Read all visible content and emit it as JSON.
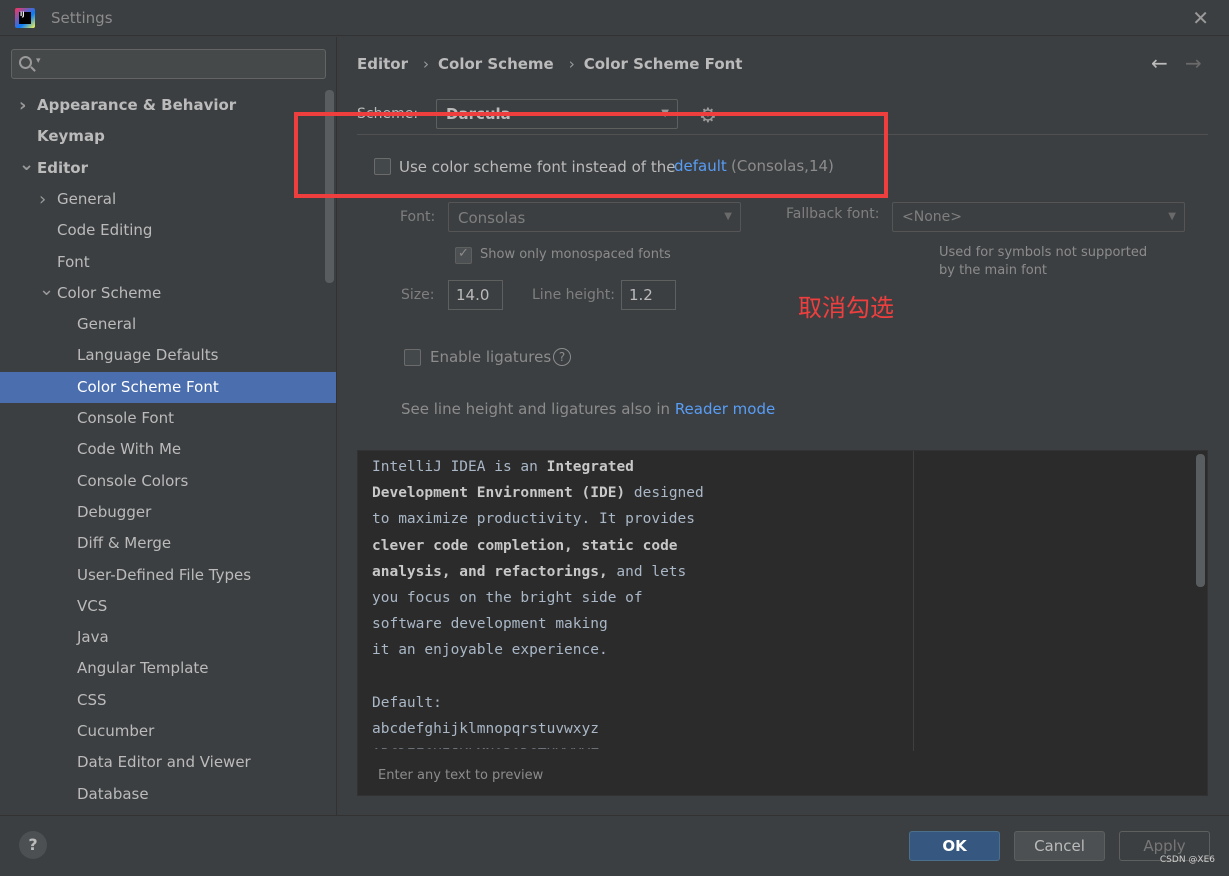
{
  "window": {
    "title": "Settings",
    "close_icon": "close-icon"
  },
  "search": {
    "placeholder": "",
    "value": ""
  },
  "tree": [
    {
      "label": "Appearance & Behavior",
      "level": 0,
      "bold": true,
      "arrow": "›",
      "selected": false
    },
    {
      "label": "Keymap",
      "level": 0,
      "bold": true,
      "arrow": "",
      "selected": false
    },
    {
      "label": "Editor",
      "level": 0,
      "bold": true,
      "arrow": "⌄",
      "selected": false
    },
    {
      "label": "General",
      "level": 1,
      "bold": false,
      "arrow": "›",
      "selected": false
    },
    {
      "label": "Code Editing",
      "level": 1,
      "bold": false,
      "arrow": "",
      "selected": false
    },
    {
      "label": "Font",
      "level": 1,
      "bold": false,
      "arrow": "",
      "selected": false
    },
    {
      "label": "Color Scheme",
      "level": 1,
      "bold": false,
      "arrow": "⌄",
      "selected": false
    },
    {
      "label": "General",
      "level": 2,
      "bold": false,
      "arrow": "",
      "selected": false
    },
    {
      "label": "Language Defaults",
      "level": 2,
      "bold": false,
      "arrow": "",
      "selected": false
    },
    {
      "label": "Color Scheme Font",
      "level": 2,
      "bold": false,
      "arrow": "",
      "selected": true
    },
    {
      "label": "Console Font",
      "level": 2,
      "bold": false,
      "arrow": "",
      "selected": false
    },
    {
      "label": "Code With Me",
      "level": 2,
      "bold": false,
      "arrow": "",
      "selected": false
    },
    {
      "label": "Console Colors",
      "level": 2,
      "bold": false,
      "arrow": "",
      "selected": false
    },
    {
      "label": "Debugger",
      "level": 2,
      "bold": false,
      "arrow": "",
      "selected": false
    },
    {
      "label": "Diff & Merge",
      "level": 2,
      "bold": false,
      "arrow": "",
      "selected": false
    },
    {
      "label": "User-Defined File Types",
      "level": 2,
      "bold": false,
      "arrow": "",
      "selected": false
    },
    {
      "label": "VCS",
      "level": 2,
      "bold": false,
      "arrow": "",
      "selected": false
    },
    {
      "label": "Java",
      "level": 2,
      "bold": false,
      "arrow": "",
      "selected": false
    },
    {
      "label": "Angular Template",
      "level": 2,
      "bold": false,
      "arrow": "",
      "selected": false
    },
    {
      "label": "CSS",
      "level": 2,
      "bold": false,
      "arrow": "",
      "selected": false
    },
    {
      "label": "Cucumber",
      "level": 2,
      "bold": false,
      "arrow": "",
      "selected": false
    },
    {
      "label": "Data Editor and Viewer",
      "level": 2,
      "bold": false,
      "arrow": "",
      "selected": false
    },
    {
      "label": "Database",
      "level": 2,
      "bold": false,
      "arrow": "",
      "selected": false
    }
  ],
  "breadcrumb": {
    "items": [
      "Editor",
      "Color Scheme",
      "Color Scheme Font"
    ],
    "separator": "›"
  },
  "nav": {
    "back": "←",
    "forward": "→"
  },
  "scheme": {
    "label": "Scheme:",
    "value": "Darcula"
  },
  "use_scheme_font": {
    "checked": false,
    "label": "Use color scheme font instead of the",
    "link": "default",
    "hint": "(Consolas,14)"
  },
  "font": {
    "label": "Font:",
    "value": "Consolas"
  },
  "fallback": {
    "label": "Fallback font:",
    "value": "<None>",
    "hint": "Used for symbols not supported by the main font"
  },
  "monospaced": {
    "checked": true,
    "label": "Show only monospaced fonts"
  },
  "size": {
    "label": "Size:",
    "value": "14.0"
  },
  "line_height": {
    "label": "Line height:",
    "value": "1.2"
  },
  "annotation": "取消勾选",
  "ligatures": {
    "checked": false,
    "label": "Enable ligatures"
  },
  "see_also": {
    "text": "See line height and ligatures also in ",
    "link": "Reader mode"
  },
  "preview": {
    "lines": [
      [
        {
          "t": "IntelliJ IDEA is an ",
          "b": false
        },
        {
          "t": "Integrated",
          "b": true
        }
      ],
      [
        {
          "t": "Development Environment (IDE)",
          "b": true
        },
        {
          "t": " designed",
          "b": false
        }
      ],
      [
        {
          "t": "to maximize productivity. It provides",
          "b": false
        }
      ],
      [
        {
          "t": "clever code completion, static code",
          "b": true
        }
      ],
      [
        {
          "t": "analysis, and refactorings,",
          "b": true
        },
        {
          "t": " and lets",
          "b": false
        }
      ],
      [
        {
          "t": "you focus on the bright side of",
          "b": false
        }
      ],
      [
        {
          "t": "software development making",
          "b": false
        }
      ],
      [
        {
          "t": "it an enjoyable experience.",
          "b": false
        }
      ],
      [
        {
          "t": "",
          "b": false
        }
      ],
      [
        {
          "t": "Default:",
          "b": false
        }
      ],
      [
        {
          "t": "abcdefghijklmnopqrstuvwxyz",
          "b": false
        }
      ],
      [
        {
          "t": "ABCDEFGHIJKLMNOPQRSTUVWXYZ",
          "b": false
        }
      ]
    ],
    "hint": "Enter any text to preview"
  },
  "footer": {
    "help": "?",
    "ok": "OK",
    "cancel": "Cancel",
    "apply": "Apply",
    "watermark": "CSDN @XE6"
  },
  "colors": {
    "selection": "#4b6eaf",
    "link": "#589df6",
    "annotation_red": "#ef3e3e",
    "primary_button": "#365880"
  }
}
